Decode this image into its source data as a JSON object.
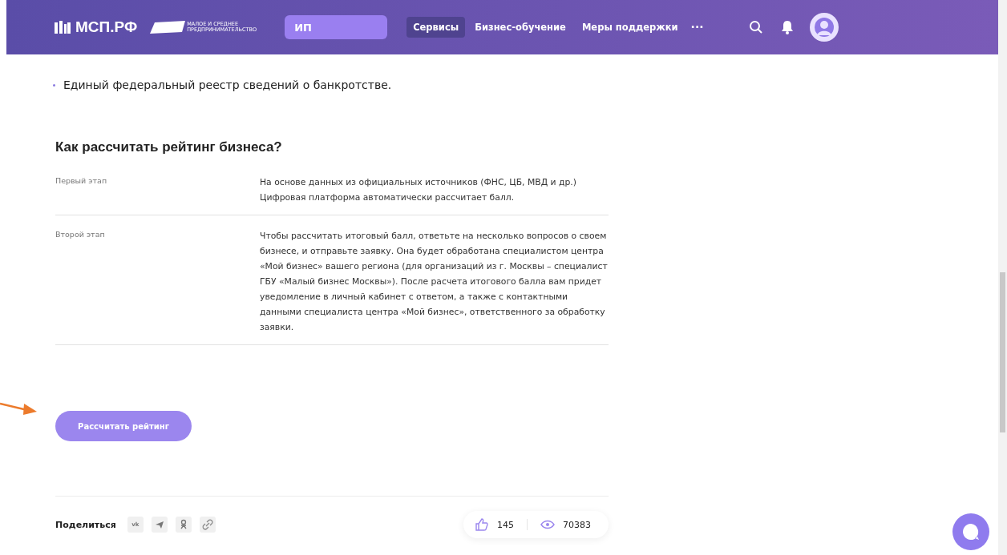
{
  "header": {
    "logo": "МСП.РФ",
    "logo_sub": "МАЛОЕ И СРЕДНЕЕ ПРЕДПРИНИМАТЕЛЬСТВО",
    "search": {
      "value": "ИП"
    },
    "nav": [
      {
        "label": "Сервисы",
        "selected": true
      },
      {
        "label": "Бизнес-обучение",
        "selected": false
      },
      {
        "label": "Меры поддержки",
        "selected": false
      }
    ],
    "more": "···"
  },
  "bullets": [
    "Единый федеральный реестр сведений о банкротстве."
  ],
  "heading": "Как рассчитать рейтинг бизнеса?",
  "steps": [
    {
      "label": "Первый этап",
      "text": "На основе данных из официальных источников (ФНС, ЦБ, МВД и др.) Цифровая платформа автоматически рассчитает балл."
    },
    {
      "label": "Второй этап",
      "text": "Чтобы рассчитать итоговый балл, ответьте на несколько вопросов о своем бизнесе, и отправьте заявку. Она будет обработана специалистом центра «Мой бизнес» вашего региона (для организаций из г. Москвы – специалист ГБУ «Малый бизнес Москвы»). После расчета итогового балла вам придет уведомление в личный кабинет с ответом, а также с контактными данными специалиста центра «Мой бизнес», ответственного за обработку заявки."
    }
  ],
  "button": "Рассчитать рейтинг",
  "share": {
    "label": "Поделиться",
    "icons": [
      {
        "kind": "vk",
        "text": "vk"
      },
      {
        "kind": "telegram"
      },
      {
        "kind": "ok"
      },
      {
        "kind": "link"
      }
    ]
  },
  "stats": {
    "likes": "145",
    "views": "70383"
  }
}
